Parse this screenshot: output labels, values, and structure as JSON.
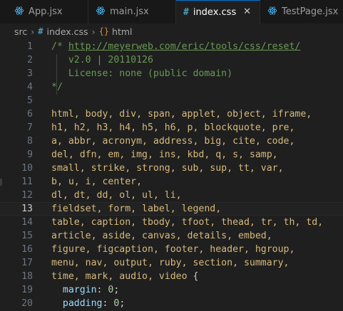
{
  "tabs": [
    {
      "label": "App.jsx",
      "icon": "react-icon",
      "active": false
    },
    {
      "label": "main.jsx",
      "icon": "react-icon",
      "active": false
    },
    {
      "label": "index.css",
      "icon": "css-hash-icon",
      "active": true
    },
    {
      "label": "TestPage.jsx",
      "icon": "react-icon",
      "active": false
    }
  ],
  "breadcrumb": {
    "folder": "src",
    "file": "index.css",
    "symbol": "html"
  },
  "colors": {
    "accent": "#0078d4",
    "comment": "#6a9955",
    "selector": "#d7ba7d",
    "property": "#9cdcfe",
    "number": "#b5cea8"
  },
  "editor": {
    "current_line": 13,
    "lines": [
      {
        "num": "1",
        "parts": [
          {
            "t": "/* ",
            "c": "c-comment"
          },
          {
            "t": "http://meyerweb.com/eric/tools/css/reset/",
            "c": "c-link"
          }
        ]
      },
      {
        "num": "2",
        "parts": [
          {
            "t": "   v2.0 | 20110126",
            "c": "c-comment"
          }
        ]
      },
      {
        "num": "3",
        "parts": [
          {
            "t": "   License: none (public domain)",
            "c": "c-comment"
          }
        ]
      },
      {
        "num": "4",
        "parts": [
          {
            "t": "*/",
            "c": "c-comment"
          }
        ]
      },
      {
        "num": "5",
        "parts": []
      },
      {
        "num": "6",
        "parts": [
          {
            "t": "html, body, div, span, applet, object, iframe,",
            "c": "c-sel"
          }
        ]
      },
      {
        "num": "7",
        "parts": [
          {
            "t": "h1, h2, h3, h4, h5, h6, p, blockquote, pre,",
            "c": "c-sel"
          }
        ]
      },
      {
        "num": "8",
        "parts": [
          {
            "t": "a, abbr, acronym, address, big, cite, code,",
            "c": "c-sel"
          }
        ]
      },
      {
        "num": "9",
        "parts": [
          {
            "t": "del, dfn, em, img, ins, kbd, q, s, samp,",
            "c": "c-sel"
          }
        ]
      },
      {
        "num": "10",
        "parts": [
          {
            "t": "small, strike, strong, sub, sup, tt, var,",
            "c": "c-sel"
          }
        ]
      },
      {
        "num": "11",
        "parts": [
          {
            "t": "b, u, i, center,",
            "c": "c-sel"
          }
        ]
      },
      {
        "num": "12",
        "parts": [
          {
            "t": "dl, dt, dd, ol, ul, li,",
            "c": "c-sel"
          }
        ]
      },
      {
        "num": "13",
        "parts": [
          {
            "t": "fieldset, form, label, legend,",
            "c": "c-sel"
          }
        ]
      },
      {
        "num": "14",
        "parts": [
          {
            "t": "table, caption, tbody, tfoot, thead, tr, th, td,",
            "c": "c-sel"
          }
        ]
      },
      {
        "num": "15",
        "parts": [
          {
            "t": "article, aside, canvas, details, embed,",
            "c": "c-sel"
          }
        ]
      },
      {
        "num": "16",
        "parts": [
          {
            "t": "figure, figcaption, footer, header, hgroup,",
            "c": "c-sel"
          }
        ]
      },
      {
        "num": "17",
        "parts": [
          {
            "t": "menu, nav, output, ruby, section, summary,",
            "c": "c-sel"
          }
        ]
      },
      {
        "num": "18",
        "parts": [
          {
            "t": "time, mark, audio, video ",
            "c": "c-sel"
          },
          {
            "t": "{",
            "c": "c-punc"
          }
        ]
      },
      {
        "num": "19",
        "parts": [
          {
            "t": "  ",
            "c": "c-punc"
          },
          {
            "t": "margin",
            "c": "c-prop"
          },
          {
            "t": ": ",
            "c": "c-punc"
          },
          {
            "t": "0",
            "c": "c-num"
          },
          {
            "t": ";",
            "c": "c-punc"
          }
        ]
      },
      {
        "num": "20",
        "parts": [
          {
            "t": "  ",
            "c": "c-punc"
          },
          {
            "t": "padding",
            "c": "c-prop"
          },
          {
            "t": ": ",
            "c": "c-punc"
          },
          {
            "t": "0",
            "c": "c-num"
          },
          {
            "t": ";",
            "c": "c-punc"
          }
        ]
      }
    ]
  }
}
